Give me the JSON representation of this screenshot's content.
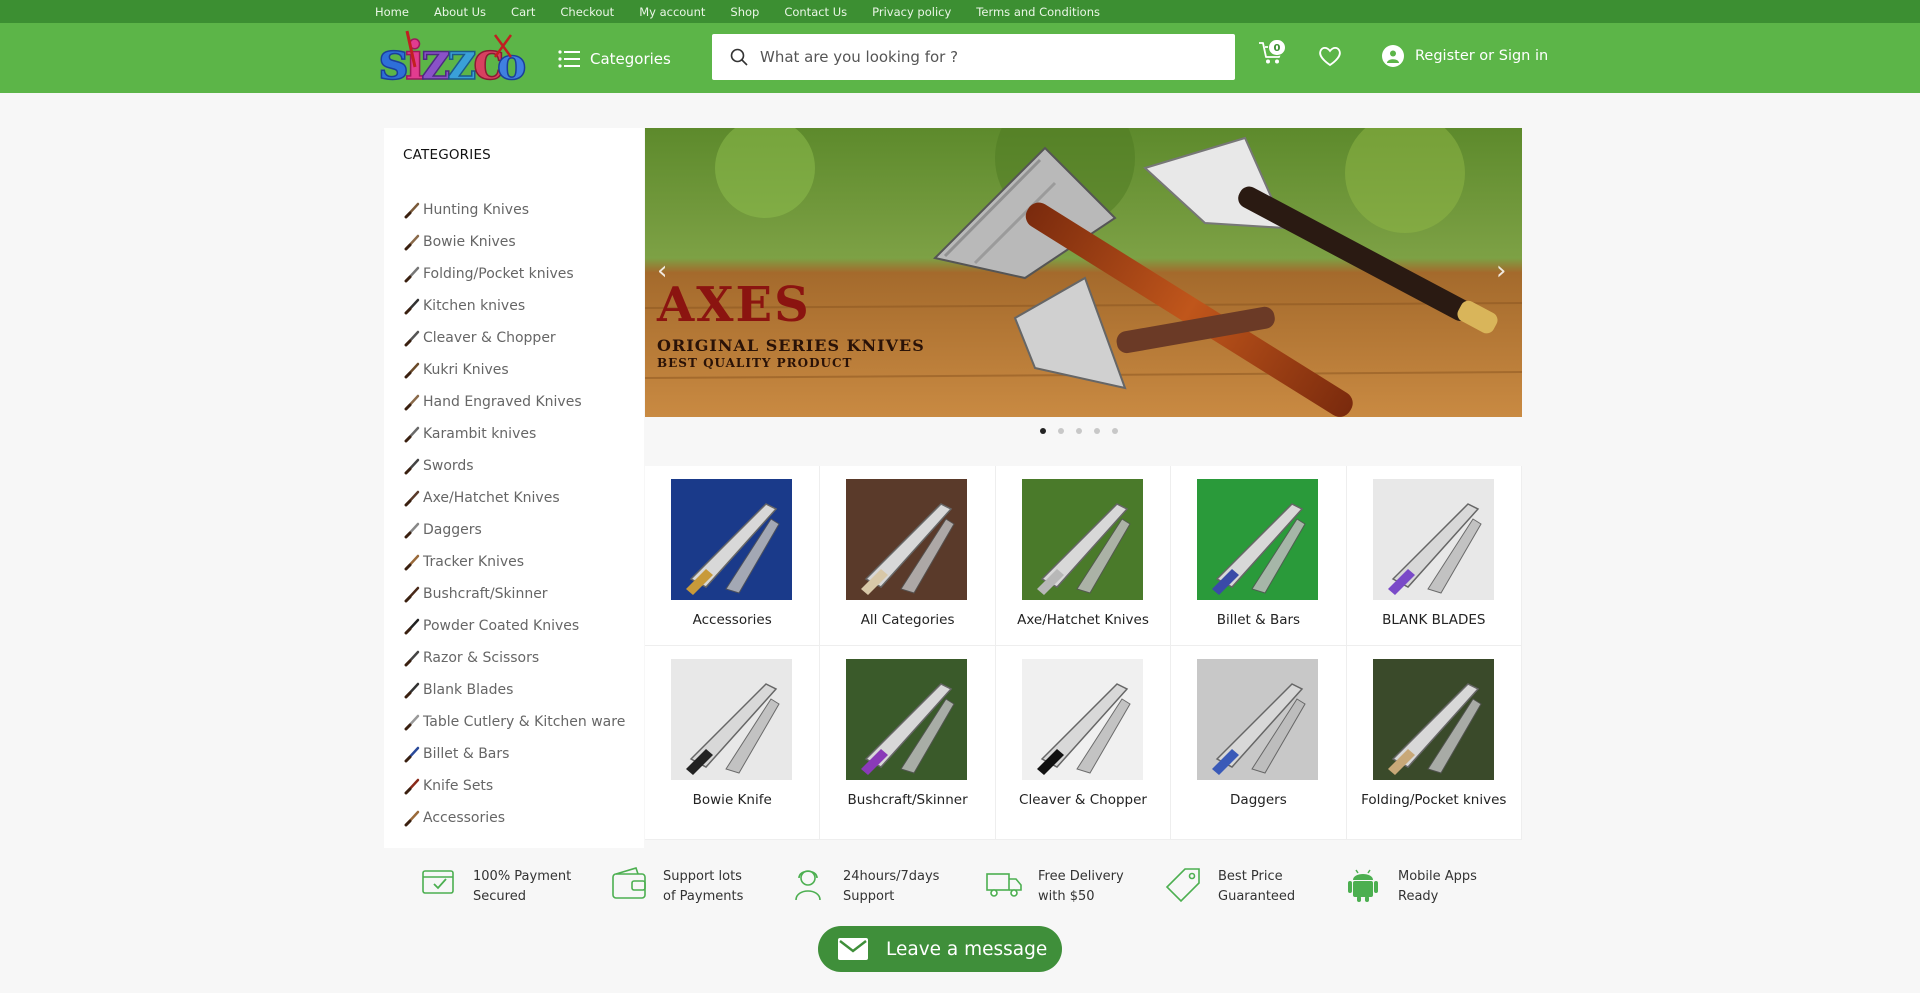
{
  "top_nav": [
    "Home",
    "About Us",
    "Cart",
    "Checkout",
    "My account",
    "Shop",
    "Contact Us",
    "Privacy policy",
    "Terms and Conditions"
  ],
  "header": {
    "logo_text": "sizzco",
    "categories_label": "Categories",
    "search_placeholder": "What are you looking for ?",
    "cart_count": "0",
    "account_label": "Register or Sign in"
  },
  "sidebar": {
    "title": "CATEGORIES",
    "items": [
      "Hunting Knives",
      " Bowie Knives",
      "Folding/Pocket knives",
      "Kitchen knives",
      "Cleaver & Chopper",
      "Kukri Knives",
      "Hand Engraved Knives",
      "Karambit knives",
      "Swords",
      "Axe/Hatchet Knives",
      "Daggers",
      "Tracker Knives",
      "Bushcraft/Skinner",
      "Powder Coated Knives",
      "Razor & Scissors",
      "Blank Blades",
      "Table Cutlery & Kitchen ware",
      "Billet & Bars",
      "Knife Sets",
      "Accessories"
    ]
  },
  "banner": {
    "title": "AXES",
    "subtitle": "ORIGINAL SERIES KNIVES",
    "tagline": "BEST QUALITY PRODUCT",
    "slides_total": 5,
    "active_slide": 1
  },
  "grid": [
    "Accessories",
    "All Categories",
    "Axe/Hatchet Knives",
    "Billet & Bars",
    "BLANK BLADES",
    "Bowie Knife",
    "Bushcraft/Skinner",
    "Cleaver & Chopper",
    "Daggers",
    "Folding/Pocket knives"
  ],
  "features": [
    {
      "line1": "100% Payment",
      "line2": "Secured",
      "icon": "secure-payment-icon"
    },
    {
      "line1": "Support lots",
      "line2": "of Payments",
      "icon": "wallet-icon"
    },
    {
      "line1": "24hours/7days",
      "line2": "Support",
      "icon": "support-agent-icon"
    },
    {
      "line1": "Free Delivery",
      "line2": "with $50",
      "icon": "delivery-truck-icon"
    },
    {
      "line1": "Best Price",
      "line2": "Guaranteed",
      "icon": "price-tag-icon"
    },
    {
      "line1": "Mobile Apps",
      "line2": "Ready",
      "icon": "android-icon"
    }
  ],
  "message_button": "Leave a message",
  "colors": {
    "brand_green": "#5cb548",
    "dark_green": "#3c8f32",
    "message_green": "#3f8f3a"
  }
}
